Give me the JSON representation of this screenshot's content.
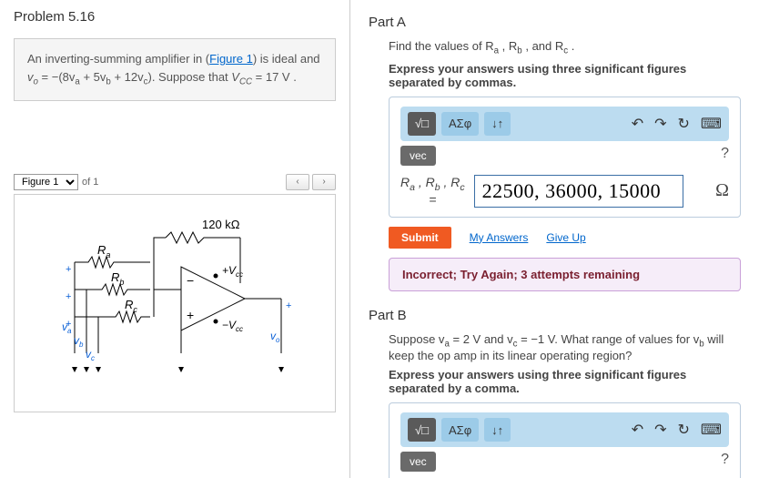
{
  "problem_title": "Problem 5.16",
  "problem_text_pre": "An inverting-summing amplifier in (",
  "figure_link": "Figure 1",
  "problem_text_mid": ") is ideal and ",
  "eq1_lhs": "v",
  "eq1_lhs_sub": "o",
  "eq1_rhs": " = −(8v",
  "eq1_rhs_a": "a",
  "eq1_rhs_2": " + 5v",
  "eq1_rhs_b": "b",
  "eq1_rhs_3": " + 12v",
  "eq1_rhs_c": "c",
  "eq1_rhs_4": "). ",
  "supp_pre": "Suppose that ",
  "supp_v": "V",
  "supp_sub": "CC",
  "supp_eq": " = 17  V .",
  "figure_sel": "Figure 1",
  "figure_of": "of 1",
  "nav_prev": "‹",
  "nav_next": "›",
  "circuit_top_r": "120 kΩ",
  "r_a": "R",
  "r_a_sub": "a",
  "r_b": "R",
  "r_b_sub": "b",
  "r_c": "R",
  "r_c_sub": "c",
  "plus_vcc": "+V",
  "plus_vcc_sub": "cc",
  "minus_vcc": "−V",
  "minus_vcc_sub": "cc",
  "va": "v",
  "va_s": "a",
  "vb": "v",
  "vb_s": "b",
  "vc": "v",
  "vc_s": "c",
  "vo": "v",
  "vo_s": "o",
  "partA_label": "Part A",
  "partA_prompt": "Find the values of R",
  "partA_prompt2": " , R",
  "partA_prompt3": " , and R",
  "partA_prompt4": " .",
  "ra_s": "a",
  "rb_s": "b",
  "rc_s": "c",
  "partA_instr": "Express your answers using three significant figures separated by commas.",
  "tb_sqrt": "√□",
  "tb_greek": "ΑΣφ",
  "tb_arrows": "↓↑",
  "undo": "↶",
  "redo": "↷",
  "reset": "↻",
  "keyb": "⌨",
  "vec": "vec",
  "qm": "?",
  "ans_vars": "R",
  "ans_a": "a",
  "ans_comma": " , R",
  "ans_b": "b",
  "ans_c": "c",
  "ans_eq": "=",
  "input_value": "22500, 36000, 15000",
  "unit": "Ω",
  "submit": "Submit",
  "myans": "My Answers",
  "giveup": "Give Up",
  "feedback": "Incorrect; Try Again; 3 attempts remaining",
  "partB_label": "Part B",
  "partB_prompt_1": "Suppose v",
  "partB_a": "a",
  "partB_eq1": " = 2 V and v",
  "partB_c": "c",
  "partB_eq2": " = −1 V. What range of values for v",
  "partB_b": "b",
  "partB_end": " will keep the op amp in its linear operating region?",
  "partB_instr": "Express your answers using three significant figures separated by a comma."
}
